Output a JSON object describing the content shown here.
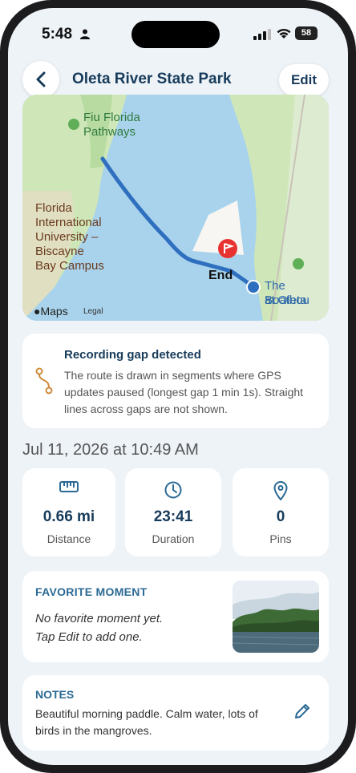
{
  "status_bar": {
    "time": "5:48",
    "battery": "58"
  },
  "nav": {
    "title": "Oleta River State Park",
    "edit_label": "Edit"
  },
  "map": {
    "labels": {
      "fiu_pathways_line1": "Fiu Florida",
      "fiu_pathways_line2": "Pathways",
      "fiu_campus_line1": "Florida",
      "fiu_campus_line2": "International",
      "fiu_campus_line3": "University –",
      "fiu_campus_line4": "Biscayne",
      "fiu_campus_line5": "Bay Campus",
      "boathouse_line1": "The Boathou",
      "boathouse_line2": "at Oleta",
      "end": "End",
      "apple_maps": "Maps",
      "legal": "Legal"
    },
    "colors": {
      "water": "#a9d3ec",
      "land": "#cfe7b8",
      "route": "#2f6fbf",
      "pin": "#e8322f"
    }
  },
  "gap_notice": {
    "title": "Recording gap detected",
    "body": "The route is drawn in segments where GPS updates paused (longest gap 1 min 1s). Straight lines across gaps are not shown."
  },
  "date": "Jul 11, 2026 at 10:49 AM",
  "stats": [
    {
      "icon": "ruler-icon",
      "value": "0.66 mi",
      "label": "Distance"
    },
    {
      "icon": "clock-icon",
      "value": "23:41",
      "label": "Duration"
    },
    {
      "icon": "pin-icon",
      "value": "0",
      "label": "Pins"
    }
  ],
  "favorite": {
    "title": "FAVORITE MOMENT",
    "line1": "No favorite moment yet.",
    "line2": "Tap Edit to add one."
  },
  "notes": {
    "title": "NOTES",
    "body": "Beautiful morning paddle. Calm water, lots of birds in the mangroves."
  }
}
